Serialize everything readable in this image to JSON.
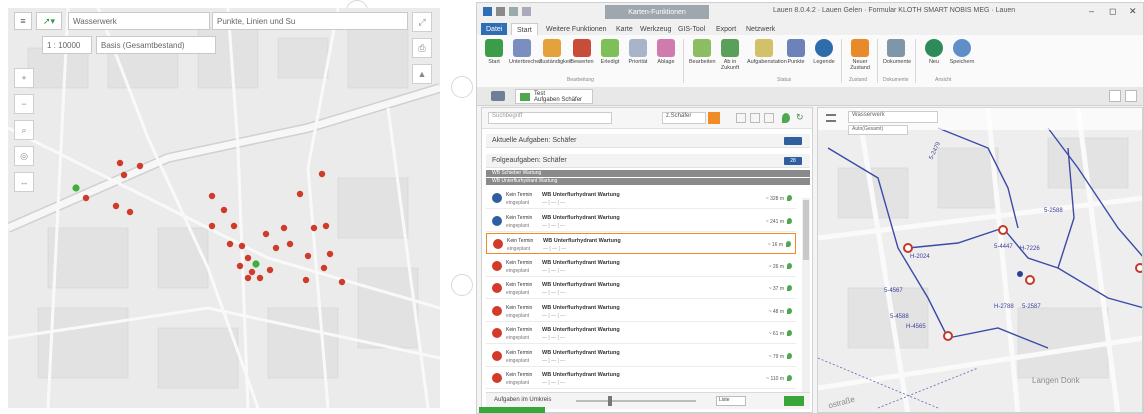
{
  "left_map": {
    "scale_value": "1 : 10000",
    "layer_select": "Basis (Gesamtbestand)",
    "search_placeholder": "Wasserwerk",
    "search_right": "Punkte, Linien und Su"
  },
  "app": {
    "context_tab": "Karten-Funktionen",
    "window_title": "Lauen 8.0.4.2 · Lauen Gelen · Formular KLOTH SMART NOBIS MEG · Lauen",
    "window_controls": [
      "–",
      "◻",
      "✕"
    ],
    "ribbon_tabs": [
      "Datei",
      "Start",
      "Weitere Funktionen",
      "Karte",
      "Werkzeug",
      "GIS-Tool",
      "Export",
      "Netzwerk"
    ],
    "ribbon_buttons": [
      {
        "label": "Start",
        "color": "#3b9d47"
      },
      {
        "label": "Unterbrechen",
        "color": "#7a8fbf"
      },
      {
        "label": "Zuständigkeit",
        "color": "#e6a23a"
      },
      {
        "label": "Bewerten",
        "color": "#c94c3b"
      },
      {
        "label": "Erledigt",
        "color": "#7fbf5a"
      },
      {
        "label": "Priorität",
        "color": "#a9b3c9"
      },
      {
        "label": "Ablage",
        "color": "#d07bb0"
      },
      {
        "label": "Bearbeiten",
        "color": "#8cbd62"
      },
      {
        "label": "Ab in Zukunft",
        "color": "#5aa05a"
      },
      {
        "label": "Aufgabenstation",
        "color": "#d3c06a"
      },
      {
        "label": "Punkte",
        "color": "#6d82b9"
      },
      {
        "label": "Legende",
        "color": "#2e6cae"
      },
      {
        "label": "Neuer Zustand",
        "color": "#e88a2a"
      },
      {
        "label": "Dokumente",
        "color": "#7f95a8"
      },
      {
        "label": "Neu",
        "color": "#2f8a5a"
      },
      {
        "label": "Speichern",
        "color": "#5f8ec9"
      }
    ],
    "ribbon_groups": [
      "Bearbeitung",
      "Status",
      "Zustand",
      "Dokumente",
      "Ansicht"
    ],
    "doc_tab": {
      "line1": "Test",
      "line2": "Aufgaben Schäfer"
    },
    "list": {
      "search_placeholder": "Suchbegriff",
      "filter_select": "z.Schäfer",
      "section_current": "Aktuelle Aufgaben: Schäfer",
      "section_followup": "Folgeaufgaben: Schäfer",
      "section_followup_count": "28",
      "group1": "WB Schieber Wartung",
      "group2": "WB Unterflurhydrant Wartung",
      "tasks": [
        {
          "t1": "Kein Termin",
          "t2": "eingeplant",
          "title": "WB Unterflurhydrant Wartung",
          "sub": "— | — | —",
          "dist": "~ 328 m",
          "icon": "#2f5f9f"
        },
        {
          "t1": "Kein Termin",
          "t2": "eingeplant",
          "title": "WB Unterflurhydrant Wartung",
          "sub": "— | — | —",
          "dist": "~ 241 m",
          "icon": "#2f5f9f"
        },
        {
          "t1": "Kein Termin",
          "t2": "eingeplant",
          "title": "WB Unterflurhydrant Wartung",
          "sub": "— | — | —",
          "dist": "~ 16 m",
          "icon": "#d23a2a"
        },
        {
          "t1": "Kein Termin",
          "t2": "eingeplant",
          "title": "WB Unterflurhydrant Wartung",
          "sub": "— | — | —",
          "dist": "~ 26 m",
          "icon": "#d23a2a"
        },
        {
          "t1": "Kein Termin",
          "t2": "eingeplant",
          "title": "WB Unterflurhydrant Wartung",
          "sub": "— | — | —",
          "dist": "~ 37 m",
          "icon": "#d23a2a"
        },
        {
          "t1": "Kein Termin",
          "t2": "eingeplant",
          "title": "WB Unterflurhydrant Wartung",
          "sub": "— | — | —",
          "dist": "~ 48 m",
          "icon": "#d23a2a"
        },
        {
          "t1": "Kein Termin",
          "t2": "eingeplant",
          "title": "WB Unterflurhydrant Wartung",
          "sub": "— | — | —",
          "dist": "~ 61 m",
          "icon": "#d23a2a"
        },
        {
          "t1": "Kein Termin",
          "t2": "eingeplant",
          "title": "WB Unterflurhydrant Wartung",
          "sub": "— | — | —",
          "dist": "~ 79 m",
          "icon": "#d23a2a"
        },
        {
          "t1": "Kein Termin",
          "t2": "eingeplant",
          "title": "WB Unterflurhydrant Wartung",
          "sub": "— | — | —",
          "dist": "~ 110 m",
          "icon": "#d23a2a"
        }
      ],
      "footer": "Aufgaben im Umkreis",
      "footer_select": "Liste"
    },
    "map": {
      "search": "Wasserwerk",
      "layer": "Auto(Gesamt)",
      "labels": [
        "5-2479",
        "5-2588",
        "5-4447",
        "H-7226",
        "H-2024",
        "5-4567",
        "5-4588",
        "H-4565",
        "H-2788",
        "5-2587",
        "Langen Donk",
        "ostraße"
      ]
    },
    "accent_orange": "#f08c28",
    "accent_blue": "#2f6db5",
    "status_green": "#3aa63a"
  }
}
